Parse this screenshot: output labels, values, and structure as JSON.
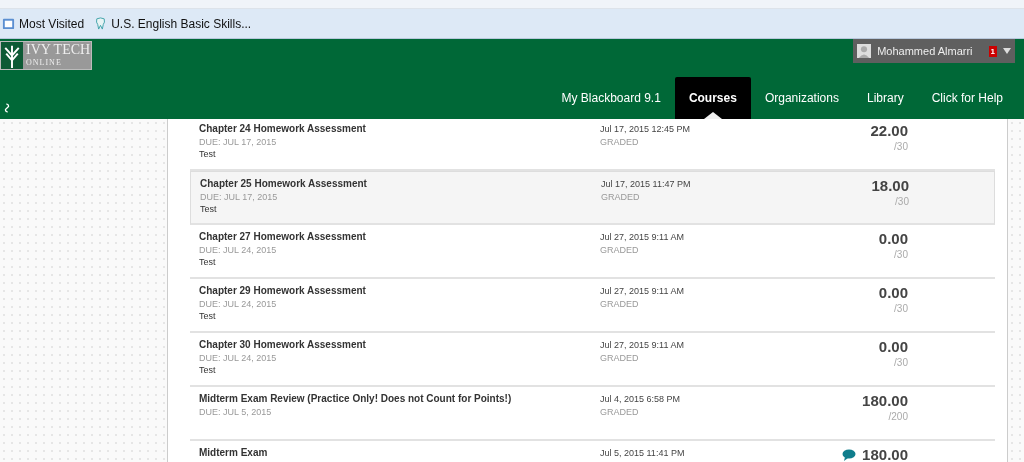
{
  "bookmarks": [
    {
      "label": "Most Visited",
      "kind": "folder"
    },
    {
      "label": "U.S. English Basic Skills...",
      "kind": "page"
    }
  ],
  "logo": {
    "title": "IVY TECH",
    "subtitle": "ONLINE"
  },
  "user": {
    "name": "Mohammed Almarri",
    "notifications": "1"
  },
  "nav": [
    {
      "label": "My Blackboard 9.1",
      "selected": false
    },
    {
      "label": "Courses",
      "selected": true
    },
    {
      "label": "Organizations",
      "selected": false
    },
    {
      "label": "Library",
      "selected": false
    },
    {
      "label": "Click for Help",
      "selected": false
    }
  ],
  "grades": [
    {
      "title": "Chapter 24 Homework Assessment",
      "due": "DUE: JUL 17, 2015",
      "category": "Test",
      "date": "Jul 17, 2015 12:45 PM",
      "status": "GRADED",
      "score": "22.00",
      "total": "/30",
      "selected": false,
      "comment": false
    },
    {
      "title": "Chapter 25 Homework Assessment",
      "due": "DUE: JUL 17, 2015",
      "category": "Test",
      "date": "Jul 17, 2015 11:47 PM",
      "status": "GRADED",
      "score": "18.00",
      "total": "/30",
      "selected": true,
      "comment": false
    },
    {
      "title": "Chapter 27 Homework Assessment",
      "due": "DUE: JUL 24, 2015",
      "category": "Test",
      "date": "Jul 27, 2015 9:11 AM",
      "status": "GRADED",
      "score": "0.00",
      "total": "/30",
      "selected": false,
      "comment": false
    },
    {
      "title": "Chapter 29 Homework Assessment",
      "due": "DUE: JUL 24, 2015",
      "category": "Test",
      "date": "Jul 27, 2015 9:11 AM",
      "status": "GRADED",
      "score": "0.00",
      "total": "/30",
      "selected": false,
      "comment": false
    },
    {
      "title": "Chapter 30 Homework Assessment",
      "due": "DUE: JUL 24, 2015",
      "category": "Test",
      "date": "Jul 27, 2015 9:11 AM",
      "status": "GRADED",
      "score": "0.00",
      "total": "/30",
      "selected": false,
      "comment": false
    },
    {
      "title": "Midterm Exam Review (Practice Only! Does not Count for Points!)",
      "due": "DUE: JUL 5, 2015",
      "date": "Jul 4, 2015 6:58 PM",
      "status": "GRADED",
      "score": "180.00",
      "total": "/200",
      "selected": false,
      "comment": false
    },
    {
      "title": "Midterm Exam",
      "date": "Jul 5, 2015 11:41 PM",
      "score": "180.00",
      "selected": false,
      "comment": true
    }
  ]
}
